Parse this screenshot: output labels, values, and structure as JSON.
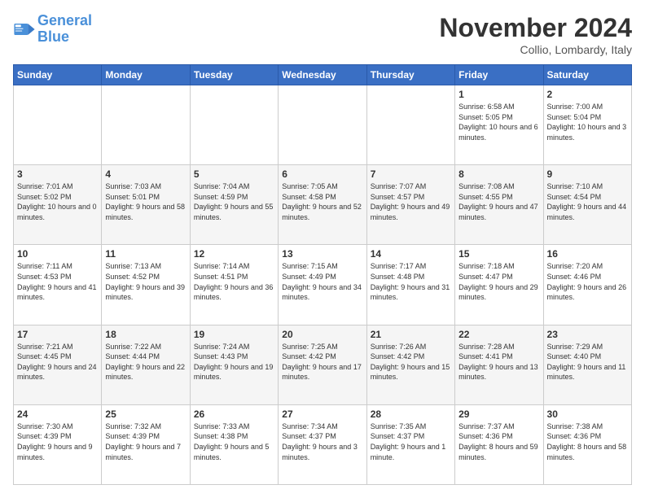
{
  "logo": {
    "line1": "General",
    "line2": "Blue"
  },
  "title": "November 2024",
  "location": "Collio, Lombardy, Italy",
  "days_header": [
    "Sunday",
    "Monday",
    "Tuesday",
    "Wednesday",
    "Thursday",
    "Friday",
    "Saturday"
  ],
  "weeks": [
    [
      {
        "day": "",
        "info": ""
      },
      {
        "day": "",
        "info": ""
      },
      {
        "day": "",
        "info": ""
      },
      {
        "day": "",
        "info": ""
      },
      {
        "day": "",
        "info": ""
      },
      {
        "day": "1",
        "info": "Sunrise: 6:58 AM\nSunset: 5:05 PM\nDaylight: 10 hours and 6 minutes."
      },
      {
        "day": "2",
        "info": "Sunrise: 7:00 AM\nSunset: 5:04 PM\nDaylight: 10 hours and 3 minutes."
      }
    ],
    [
      {
        "day": "3",
        "info": "Sunrise: 7:01 AM\nSunset: 5:02 PM\nDaylight: 10 hours and 0 minutes."
      },
      {
        "day": "4",
        "info": "Sunrise: 7:03 AM\nSunset: 5:01 PM\nDaylight: 9 hours and 58 minutes."
      },
      {
        "day": "5",
        "info": "Sunrise: 7:04 AM\nSunset: 4:59 PM\nDaylight: 9 hours and 55 minutes."
      },
      {
        "day": "6",
        "info": "Sunrise: 7:05 AM\nSunset: 4:58 PM\nDaylight: 9 hours and 52 minutes."
      },
      {
        "day": "7",
        "info": "Sunrise: 7:07 AM\nSunset: 4:57 PM\nDaylight: 9 hours and 49 minutes."
      },
      {
        "day": "8",
        "info": "Sunrise: 7:08 AM\nSunset: 4:55 PM\nDaylight: 9 hours and 47 minutes."
      },
      {
        "day": "9",
        "info": "Sunrise: 7:10 AM\nSunset: 4:54 PM\nDaylight: 9 hours and 44 minutes."
      }
    ],
    [
      {
        "day": "10",
        "info": "Sunrise: 7:11 AM\nSunset: 4:53 PM\nDaylight: 9 hours and 41 minutes."
      },
      {
        "day": "11",
        "info": "Sunrise: 7:13 AM\nSunset: 4:52 PM\nDaylight: 9 hours and 39 minutes."
      },
      {
        "day": "12",
        "info": "Sunrise: 7:14 AM\nSunset: 4:51 PM\nDaylight: 9 hours and 36 minutes."
      },
      {
        "day": "13",
        "info": "Sunrise: 7:15 AM\nSunset: 4:49 PM\nDaylight: 9 hours and 34 minutes."
      },
      {
        "day": "14",
        "info": "Sunrise: 7:17 AM\nSunset: 4:48 PM\nDaylight: 9 hours and 31 minutes."
      },
      {
        "day": "15",
        "info": "Sunrise: 7:18 AM\nSunset: 4:47 PM\nDaylight: 9 hours and 29 minutes."
      },
      {
        "day": "16",
        "info": "Sunrise: 7:20 AM\nSunset: 4:46 PM\nDaylight: 9 hours and 26 minutes."
      }
    ],
    [
      {
        "day": "17",
        "info": "Sunrise: 7:21 AM\nSunset: 4:45 PM\nDaylight: 9 hours and 24 minutes."
      },
      {
        "day": "18",
        "info": "Sunrise: 7:22 AM\nSunset: 4:44 PM\nDaylight: 9 hours and 22 minutes."
      },
      {
        "day": "19",
        "info": "Sunrise: 7:24 AM\nSunset: 4:43 PM\nDaylight: 9 hours and 19 minutes."
      },
      {
        "day": "20",
        "info": "Sunrise: 7:25 AM\nSunset: 4:42 PM\nDaylight: 9 hours and 17 minutes."
      },
      {
        "day": "21",
        "info": "Sunrise: 7:26 AM\nSunset: 4:42 PM\nDaylight: 9 hours and 15 minutes."
      },
      {
        "day": "22",
        "info": "Sunrise: 7:28 AM\nSunset: 4:41 PM\nDaylight: 9 hours and 13 minutes."
      },
      {
        "day": "23",
        "info": "Sunrise: 7:29 AM\nSunset: 4:40 PM\nDaylight: 9 hours and 11 minutes."
      }
    ],
    [
      {
        "day": "24",
        "info": "Sunrise: 7:30 AM\nSunset: 4:39 PM\nDaylight: 9 hours and 9 minutes."
      },
      {
        "day": "25",
        "info": "Sunrise: 7:32 AM\nSunset: 4:39 PM\nDaylight: 9 hours and 7 minutes."
      },
      {
        "day": "26",
        "info": "Sunrise: 7:33 AM\nSunset: 4:38 PM\nDaylight: 9 hours and 5 minutes."
      },
      {
        "day": "27",
        "info": "Sunrise: 7:34 AM\nSunset: 4:37 PM\nDaylight: 9 hours and 3 minutes."
      },
      {
        "day": "28",
        "info": "Sunrise: 7:35 AM\nSunset: 4:37 PM\nDaylight: 9 hours and 1 minute."
      },
      {
        "day": "29",
        "info": "Sunrise: 7:37 AM\nSunset: 4:36 PM\nDaylight: 8 hours and 59 minutes."
      },
      {
        "day": "30",
        "info": "Sunrise: 7:38 AM\nSunset: 4:36 PM\nDaylight: 8 hours and 58 minutes."
      }
    ]
  ]
}
